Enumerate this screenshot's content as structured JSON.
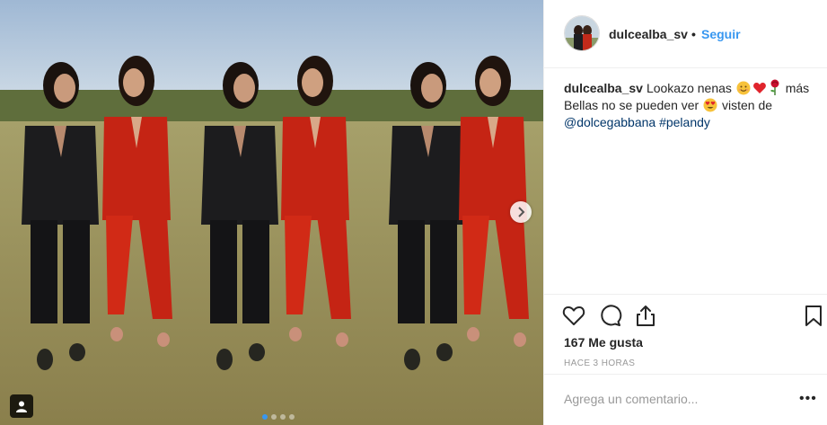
{
  "post": {
    "username": "dulcealba_sv",
    "follow_label": "Seguir",
    "separator": "•",
    "caption": {
      "username": "dulcealba_sv",
      "text_1": "Lookazo nenas",
      "text_2": "más Bellas no se pueden ver",
      "text_3": "visten de",
      "mention": "@dolcegabbana",
      "hashtag": "#pelandy",
      "emojis": [
        "smiling-face-emoji",
        "red-heart-emoji",
        "rose-emoji",
        "heart-eyes-emoji"
      ]
    },
    "likes": "167 Me gusta",
    "timestamp": "HACE 3 HORAS",
    "comment_placeholder": "Agrega un comentario...",
    "more_label": "•••"
  },
  "media": {
    "carousel_total": 4,
    "carousel_active": 1,
    "icons": [
      "carousel-next-icon",
      "tagged-user-icon"
    ]
  },
  "colors": {
    "accent_blue": "#3897f0",
    "text": "#262626",
    "muted": "#999999",
    "border": "#efefef"
  }
}
